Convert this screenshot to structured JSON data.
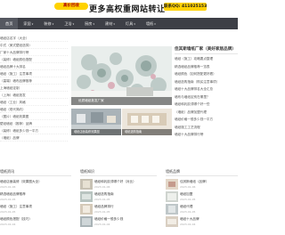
{
  "banner": {
    "tag": "高价回收",
    "title": "更多高权重网站转让",
    "contact": "联系QQ: 411025153"
  },
  "nav": {
    "items": [
      {
        "label": "首页",
        "active": true
      },
      {
        "label": "家居",
        "caret": true
      },
      {
        "label": "装修",
        "caret": true
      },
      {
        "label": "卫浴",
        "caret": true
      },
      {
        "label": "厨房",
        "caret": true
      },
      {
        "label": "建材",
        "caret": true
      },
      {
        "label": "灯具",
        "caret": true
      },
      {
        "label": "墙纸",
        "caret": true
      }
    ]
  },
  "left_list": [
    "墙纸店名字（大全）",
    "中式（美式壁纸选择）",
    "厂家十大品牌排行榜",
    "（装修）墙纸颜色搭配",
    "墙纸品牌十大排名",
    "墙纸（施工）注意事项",
    "（高端）墙布品牌推荐",
    "上海墙纸定制",
    "（上海）墙纸批发",
    "墙纸（工业）风格",
    "墙纸（现代简约）",
    "（图片）墙纸效果图",
    "壁纸墙纸（推荐）品牌",
    "（装修）墙纸多少钱一平方",
    "（墙纸）品牌"
  ],
  "hero": {
    "caption": "优质墙纸批发厂家",
    "thumbs": [
      {
        "caption": "墙纸店面装修效果图"
      },
      {
        "caption": "墙纸选购指南"
      }
    ]
  },
  "right_panel": {
    "title": "佳其斯墙纸厂家（美好家居品牌）",
    "items": [
      "墙纸（施工）攻略要点整理",
      "精选墙纸品牌推荐一览表",
      "墙纸颜色（如何搭配更好看）",
      "墙纸选购指南（购买注意事项）",
      "墙纸十大品牌排名大全汇总",
      "墙布与墙纸区别在哪里？",
      "墙纸和乳胶漆哪个好一些",
      "（墙纸）品牌加盟代理",
      "墙纸价格一般多少钱一平方",
      "墙纸施工工艺流程",
      "墙纸十大品牌排行榜"
    ]
  },
  "sections": [
    {
      "title": "墙纸资讯",
      "items": [
        {
          "text": "墙纸店面装修（效果图大全）",
          "date": "2023-01-06"
        },
        {
          "text": "精选墙纸品牌推荐",
          "date": "2023-01-05"
        },
        {
          "text": "墙纸（施工）注意事项",
          "date": "2023-01-05"
        },
        {
          "text": "墙纸颜色搭配（技巧）",
          "date": "2023-01-04"
        }
      ]
    },
    {
      "title": "墙纸知识",
      "items": [
        {
          "text": "墙纸和乳胶漆哪个好（对比）",
          "date": "2023-01-06"
        },
        {
          "text": "墙纸选购指南",
          "date": "2023-01-05"
        },
        {
          "text": "墙纸品牌排行",
          "date": "2023-01-05"
        },
        {
          "text": "墙纸价格一般多少钱",
          "date": "2023-01-04"
        }
      ]
    },
    {
      "title": "墙纸品牌",
      "items": [
        {
          "text": "佳其斯墙纸（品牌）",
          "date": "2023-01-06"
        },
        {
          "text": "墙纸加盟",
          "date": "2023-01-05"
        },
        {
          "text": "墙纸代理",
          "date": "2023-01-05"
        },
        {
          "text": "墙纸十大品牌",
          "date": "2023-01-04"
        }
      ]
    }
  ]
}
